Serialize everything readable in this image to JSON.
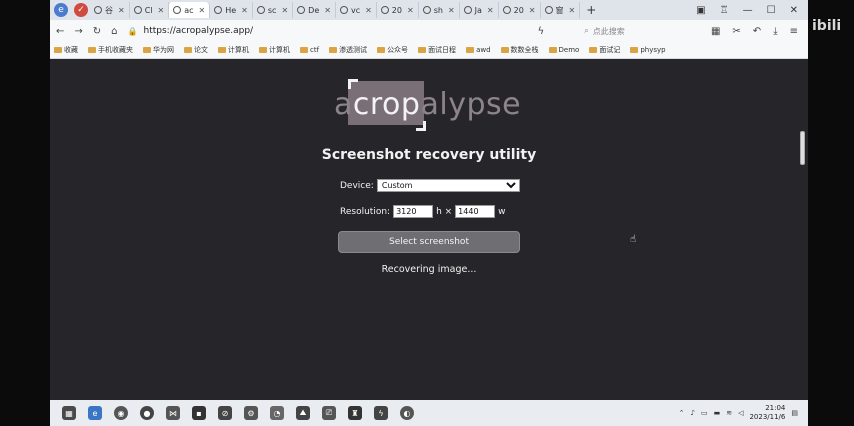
{
  "browser": {
    "tabs": [
      {
        "label": "谷"
      },
      {
        "label": "Cl"
      },
      {
        "label": "ac",
        "active": true
      },
      {
        "label": "He"
      },
      {
        "label": "sc"
      },
      {
        "label": "De"
      },
      {
        "label": "vc"
      },
      {
        "label": "20"
      },
      {
        "label": "sh"
      },
      {
        "label": "Ja"
      },
      {
        "label": "20"
      },
      {
        "label": "窗"
      }
    ],
    "new_tab": "+",
    "url": "https://acropalypse.app/",
    "search_placeholder": "点此搜索",
    "bookmarks": [
      {
        "label": "收藏"
      },
      {
        "label": "手机收藏夹"
      },
      {
        "label": "华为网"
      },
      {
        "label": "论文"
      },
      {
        "label": "计算机"
      },
      {
        "label": "计算机"
      },
      {
        "label": "ctf"
      },
      {
        "label": "渗透测试"
      },
      {
        "label": "公众号"
      },
      {
        "label": "面试日程"
      },
      {
        "label": "awd"
      },
      {
        "label": "数数全栈"
      },
      {
        "label": "Demo"
      },
      {
        "label": "面试记"
      },
      {
        "label": "physyp"
      }
    ]
  },
  "app": {
    "logo_prefix": "a",
    "logo_crop": "crop",
    "logo_suffix": "alypse",
    "title": "Screenshot recovery utility",
    "device_label": "Device:",
    "device_selected": "Custom",
    "resolution_label": "Resolution:",
    "res_width": "3120",
    "res_h_label": "h ×",
    "res_height": "1440",
    "res_w_label": "w",
    "select_button": "Select screenshot",
    "status": "Recovering image..."
  },
  "overlay": {
    "bilibili": "ibili"
  },
  "taskbar": {
    "time": "21:04",
    "date": "2023/11/6"
  },
  "colors": {
    "page_bg": "#26262a",
    "button_bg": "#6e6e73",
    "logo_box": "#7a6f76"
  }
}
